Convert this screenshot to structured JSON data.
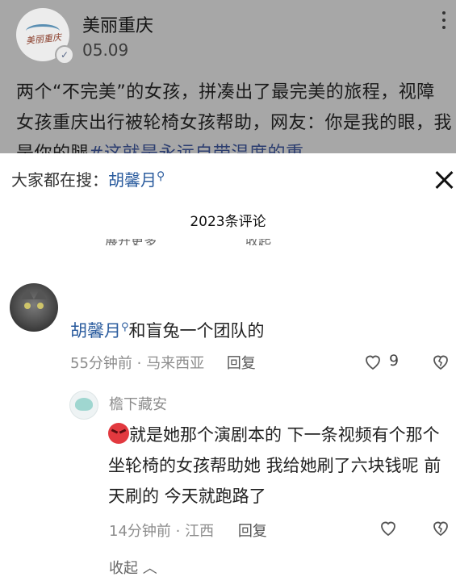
{
  "post": {
    "logo_text": "美丽重庆",
    "author": "美丽重庆",
    "date": "05.09",
    "text": "两个“不完美”的女孩，拼凑出了最完美的旅程，视障女孩重庆出行被轮椅女孩帮助，网友：你是我的眼，我是你的腿",
    "hashtag": "#这就是永远自带温度的重"
  },
  "sheet": {
    "search_prefix": "大家都在搜：",
    "search_keyword": "胡馨月",
    "comment_count": "2023条评论",
    "clipped_expand": "展开更多",
    "clipped_collapse": "收起"
  },
  "comment": {
    "keyword": "胡馨月",
    "text": "和盲兔一个团队的",
    "time_location": "55分钟前 · 马来西亚",
    "reply": "回复",
    "likes": "9"
  },
  "reply": {
    "author": "檐下藏安",
    "text": "就是她那个演剧本的 下一条视频有个那个坐轮椅的女孩帮助她 我给她刷了六块钱呢 前天刷的 今天就跑路了",
    "time_location": "14分钟前 · 江西",
    "reply": "回复"
  },
  "collapse_label": "收起"
}
